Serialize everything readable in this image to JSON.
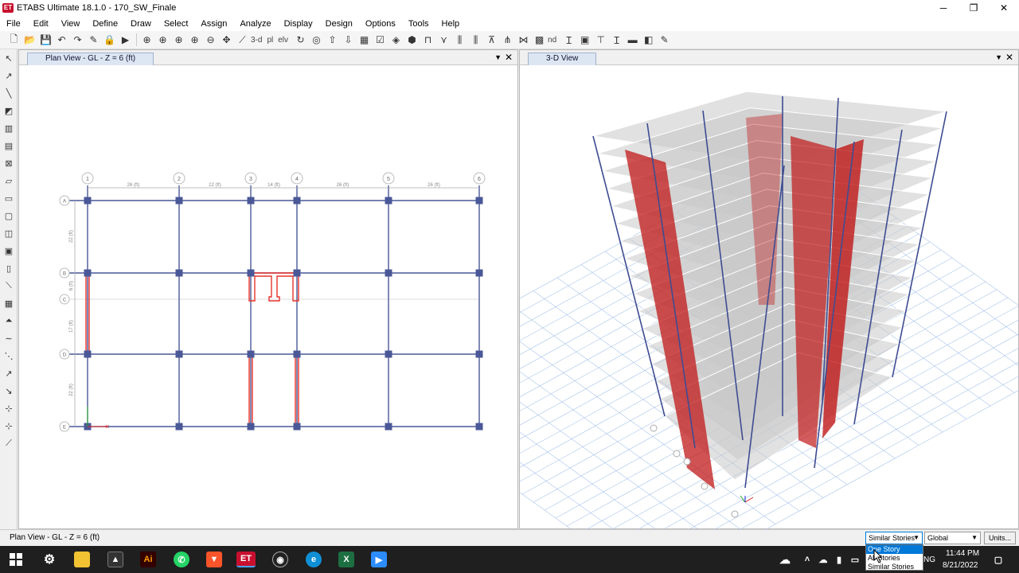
{
  "app": {
    "logo": "ET",
    "title": "ETABS Ultimate 18.1.0 - 170_SW_Finale",
    "minimize": "─",
    "maximize": "❐",
    "close": "✕"
  },
  "menu": [
    "File",
    "Edit",
    "View",
    "Define",
    "Draw",
    "Select",
    "Assign",
    "Analyze",
    "Display",
    "Design",
    "Options",
    "Tools",
    "Help"
  ],
  "toolbar": {
    "view_3d_label": "3-d",
    "view_plan_label": "pl",
    "view_elev_label": "elv",
    "nd_label": "nd"
  },
  "plan_view": {
    "tab_label": "Plan View - GL - Z = 6 (ft)",
    "grid_cols": [
      "1",
      "2",
      "3",
      "4",
      "5",
      "6"
    ],
    "grid_rows": [
      "A",
      "B",
      "C",
      "D",
      "E"
    ],
    "col_dims": [
      "26 (ft)",
      "22 (ft)",
      "14 (ft)",
      "26 (ft)",
      "26 (ft)"
    ],
    "row_dims": [
      "22 (ft)",
      "6 (ft)",
      "17 (ft)",
      "22 (ft)"
    ],
    "shear_wall_color": "#e8332c",
    "grid_line_color": "#4a5898",
    "column_color": "#4a5898"
  },
  "view_3d": {
    "tab_label": "3-D View",
    "slab_color": "#c8c8c8",
    "wall_color": "#c01818",
    "column_color": "#3e4c92",
    "ground_grid_color": "#a9c5ea"
  },
  "pane_controls": {
    "menu_arrow": "▼",
    "close": "✕"
  },
  "statusbar": {
    "text": "Plan View - GL - Z = 6 (ft)",
    "story_select": "Similar Stories",
    "coord_select": "Global",
    "units_button": "Units..."
  },
  "story_dropdown": {
    "options": [
      "One Story",
      "All Stories",
      "Similar Stories"
    ],
    "highlighted": "One Story"
  },
  "taskbar": {
    "clock_time": "11:44 PM",
    "clock_date": "8/21/2022",
    "lang": "NG",
    "apps": [
      "windows-start",
      "settings",
      "file-explorer",
      "terminal",
      "illustrator",
      "whatsapp",
      "brave",
      "etabs",
      "obs",
      "edge",
      "excel",
      "zoom"
    ]
  }
}
